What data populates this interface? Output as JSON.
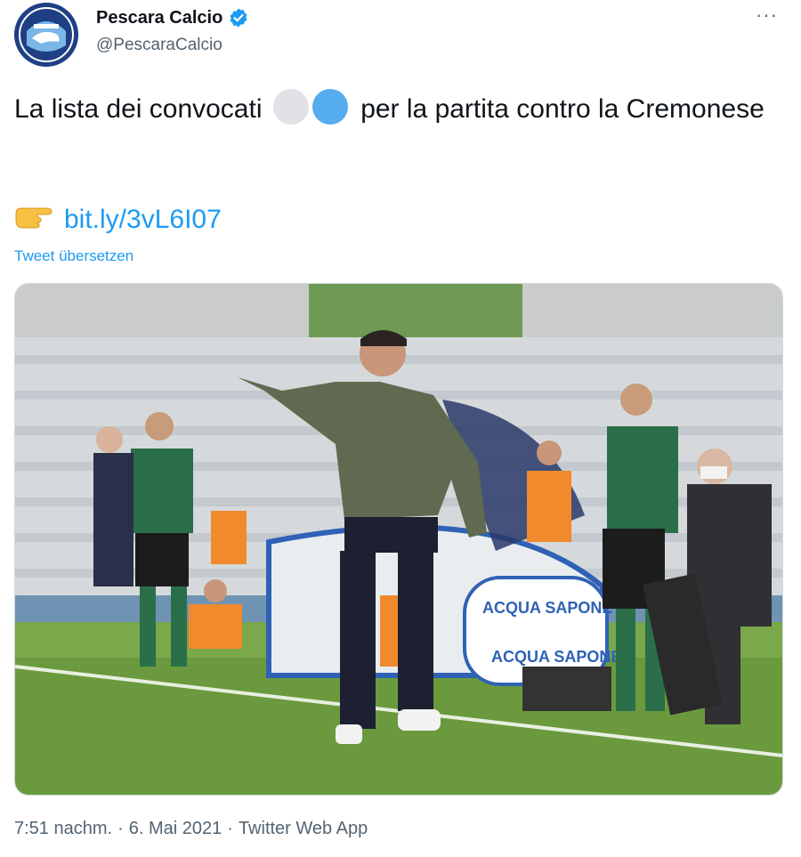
{
  "header": {
    "display_name": "Pescara Calcio",
    "handle": "@PescaraCalcio",
    "verified_icon": "verified-badge-icon",
    "more_icon": "more-options-icon",
    "more_label": "···"
  },
  "tweet": {
    "text_before": "La lista dei convocati",
    "emoji_1": "white-circle-icon",
    "emoji_2": "blue-circle-icon",
    "text_after": "per la partita contro la Cremonese",
    "link_emoji": "backhand-index-pointing-right-icon",
    "link": "bit.ly/3vL6I07",
    "translate_label": "Tweet übersetzen"
  },
  "photo": {
    "alt": "Pescara coach pointing on the sideline with referees behind",
    "banner_text_1": "ACQUA SAPONE",
    "banner_text_2": "ACQUA SAPONE"
  },
  "footer": {
    "time": "7:51 nachm.",
    "separator": "·",
    "date": "6. Mai 2021",
    "source": "Twitter Web App"
  },
  "colors": {
    "link": "#1d9bf0",
    "secondary_text": "#536471",
    "verified": "#1d9bf0",
    "avatar_bg": "#1f3f85"
  }
}
